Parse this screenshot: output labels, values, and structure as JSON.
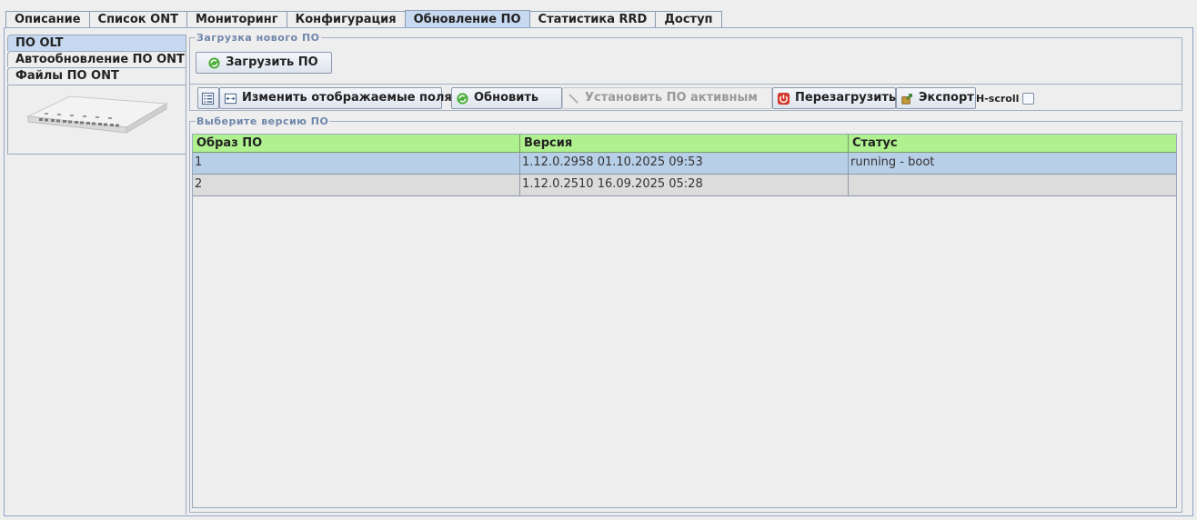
{
  "tabs": [
    "Описание",
    "Список ONT",
    "Мониторинг",
    "Конфигурация",
    "Обновление ПО",
    "Статистика RRD",
    "Доступ"
  ],
  "active_tab": "Обновление ПО",
  "left_nav": {
    "items": [
      "ПО OLT",
      "Автообновление ПО ONT",
      "Файлы ПО ONT"
    ],
    "active": "ПО OLT"
  },
  "upload_group": {
    "legend": "Загрузка нового ПО",
    "button": "Загрузить ПО"
  },
  "toolbar": {
    "columns_label": "Изменить отображаемые поля",
    "refresh_label": "Обновить",
    "set_active_label": "Установить ПО активным",
    "reboot_label": "Перезагрузить",
    "export_label": "Экспорт",
    "hscroll_label": "H-scroll",
    "hscroll_checked": false
  },
  "versions_group": {
    "legend": "Выберите версию ПО",
    "columns": [
      "Образ ПО",
      "Версия",
      "Статус"
    ],
    "rows": [
      {
        "image": "1",
        "version": "1.12.0.2958 01.10.2025 09:53",
        "status": "running - boot",
        "selected": true
      },
      {
        "image": "2",
        "version": "1.12.0.2510 16.09.2025 05:28",
        "status": "",
        "selected": false
      }
    ]
  },
  "colors": {
    "tab_active": "#c7d9f0",
    "header_bg": "#aff08f",
    "row_selected": "#b8cfe8",
    "legend_text": "#6f86aa"
  }
}
